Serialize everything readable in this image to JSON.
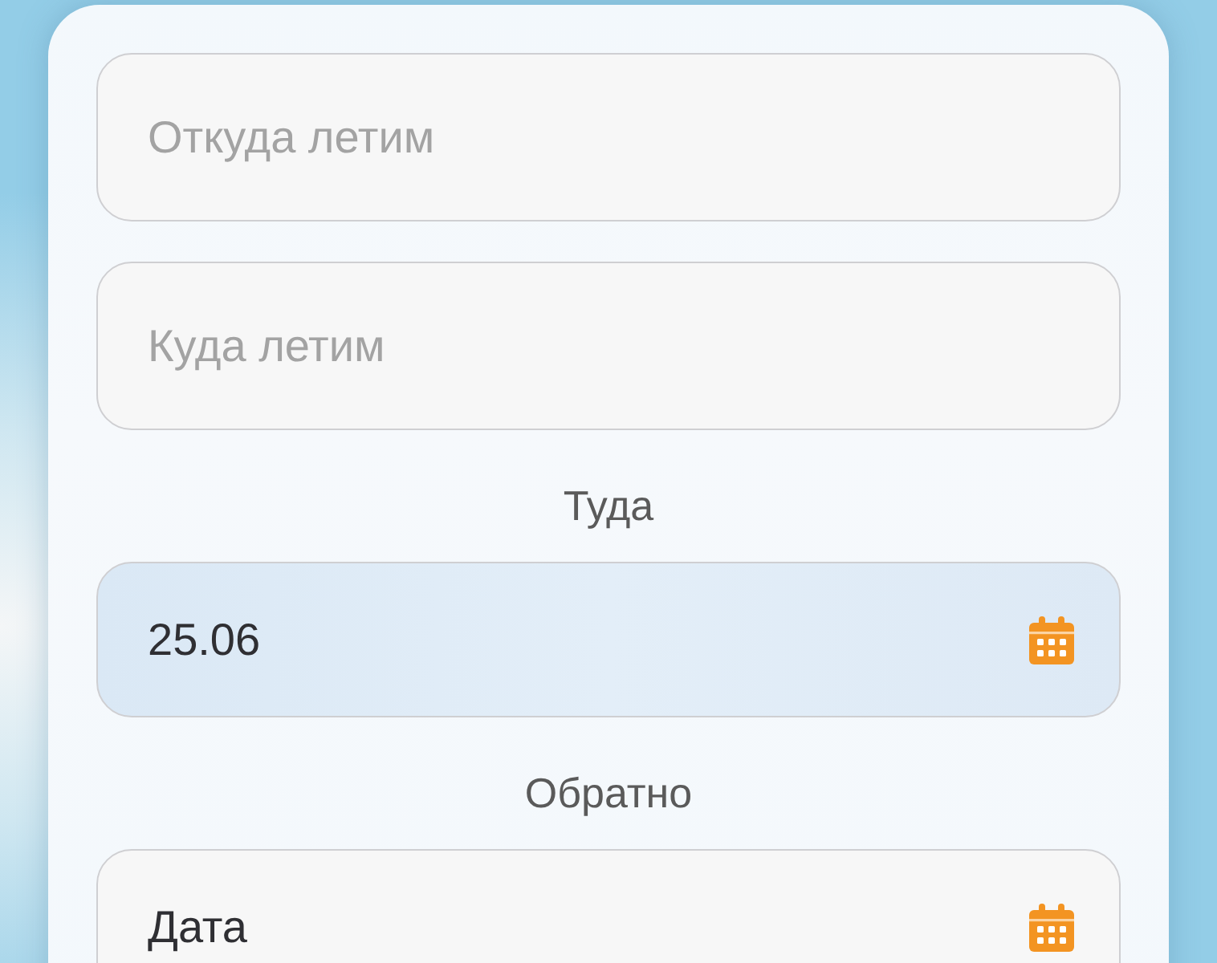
{
  "route_fields": [
    {
      "placeholder": "Откуда летим"
    },
    {
      "placeholder": "Куда летим"
    }
  ],
  "date_fields": [
    {
      "label": "Туда",
      "value": "25.06",
      "filled": true
    },
    {
      "label": "Обратно",
      "value": "Дата",
      "filled": false
    }
  ]
}
